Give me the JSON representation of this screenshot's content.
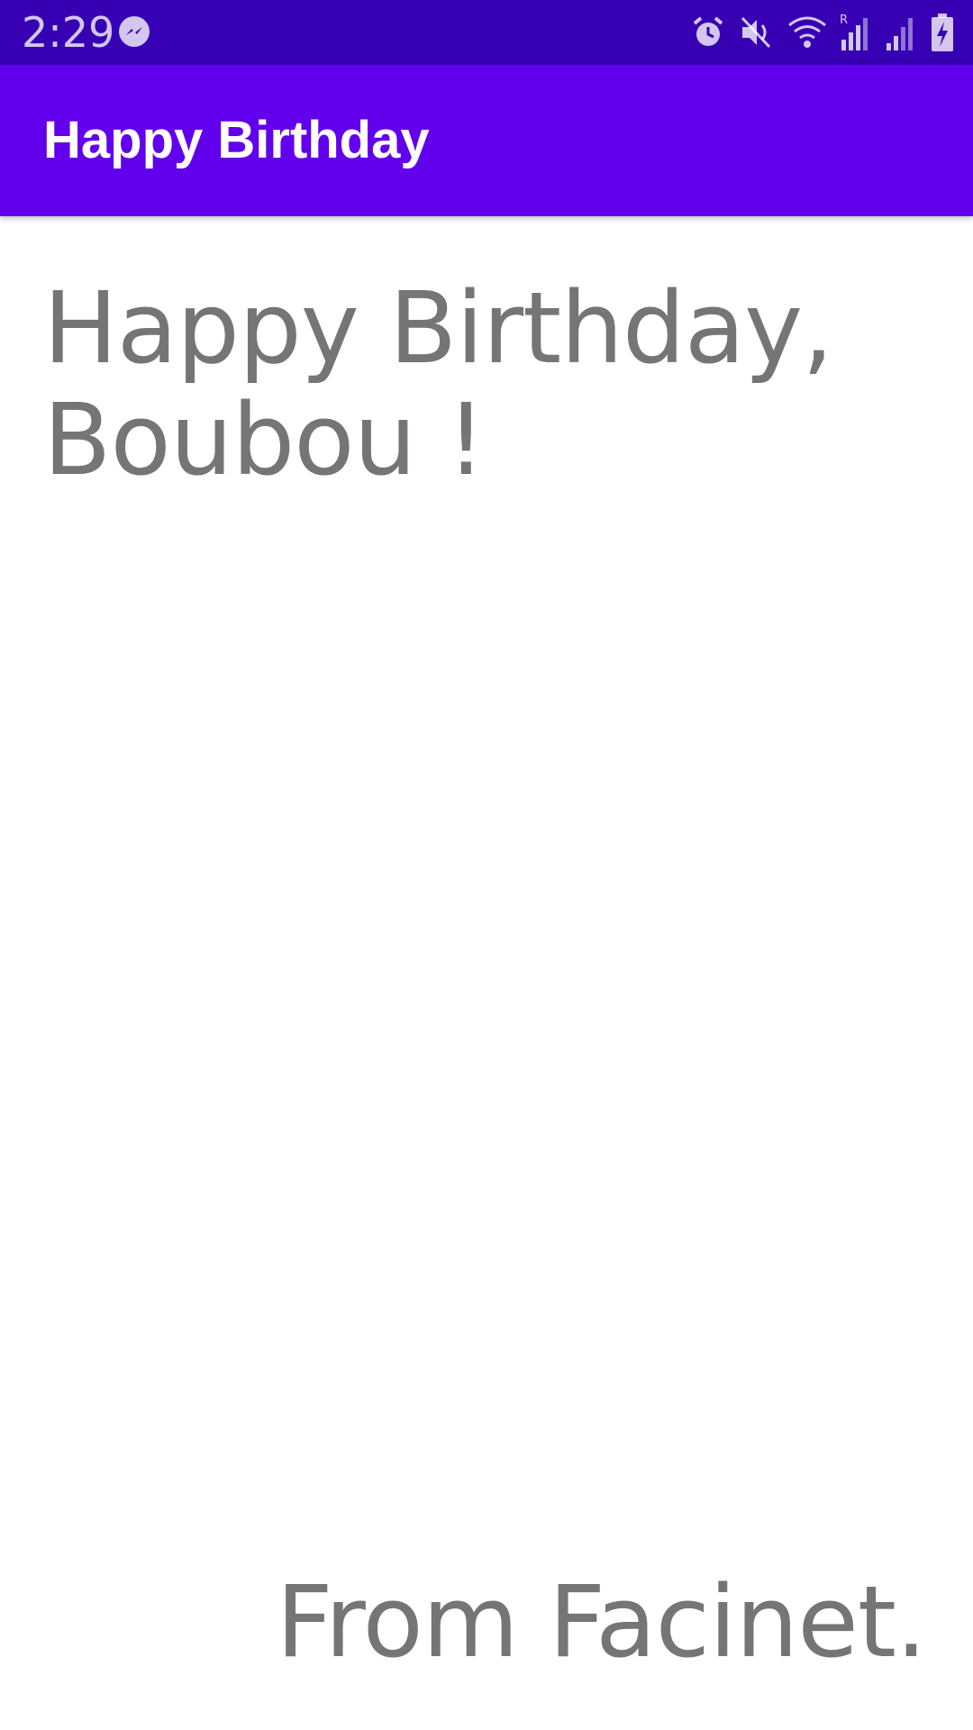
{
  "status_bar": {
    "time": "2:29",
    "left_icons": [
      "messenger-icon"
    ],
    "right_icons": [
      "alarm-icon",
      "mute-icon",
      "wifi-icon",
      "signal-roaming-icon",
      "signal-icon",
      "battery-charging-icon"
    ],
    "background": "#3700B3"
  },
  "app_bar": {
    "title": "Happy Birthday",
    "background": "#6200EE"
  },
  "content": {
    "greeting": "Happy Birthday, Boubou !",
    "signature": "From Facinet.",
    "text_color": "#757575"
  }
}
